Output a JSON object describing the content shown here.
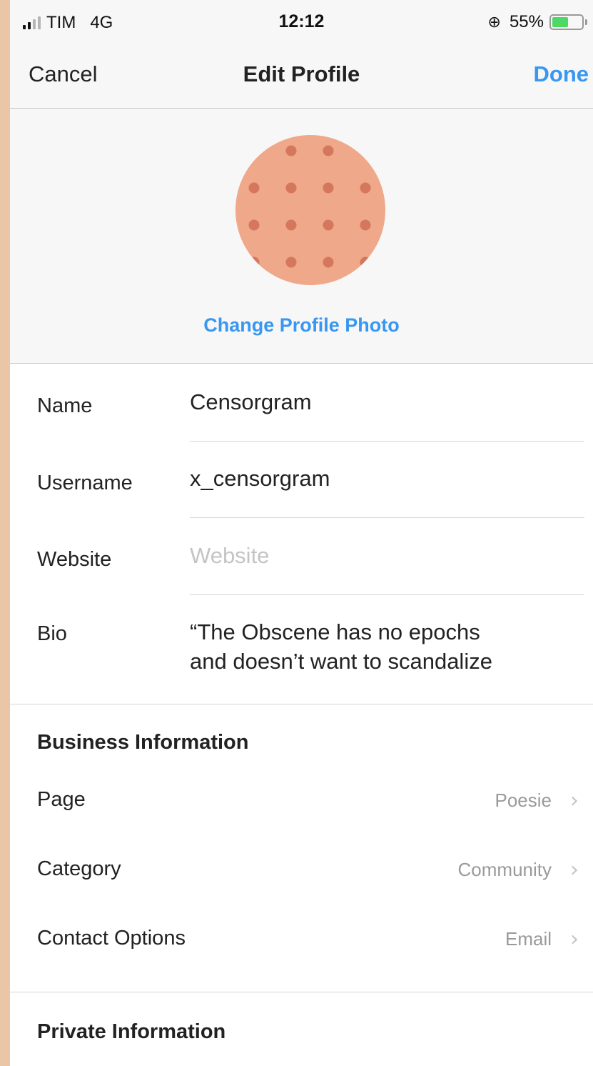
{
  "status_bar": {
    "carrier": "TIM",
    "network": "4G",
    "time": "12:12",
    "battery": "55%",
    "battery_level": 0.55
  },
  "nav": {
    "cancel": "Cancel",
    "title": "Edit Profile",
    "done": "Done"
  },
  "profile": {
    "change_photo": "Change Profile Photo"
  },
  "fields": {
    "name": {
      "label": "Name",
      "value": "Censorgram"
    },
    "username": {
      "label": "Username",
      "value": "x_censorgram"
    },
    "website": {
      "label": "Website",
      "value": "",
      "placeholder": "Website"
    },
    "bio": {
      "label": "Bio",
      "line1": "“The Obscene has no epochs",
      "line2": "and doesn’t want to scandalize"
    }
  },
  "business": {
    "header": "Business Information",
    "items": [
      {
        "label": "Page",
        "value": "Poesie"
      },
      {
        "label": "Category",
        "value": "Community"
      },
      {
        "label": "Contact Options",
        "value": "Email"
      }
    ]
  },
  "private": {
    "header": "Private Information"
  },
  "colors": {
    "accent": "#3897f0",
    "background": "#e9c6a6",
    "battery": "#4cd964"
  },
  "icons": [
    "signal-icon",
    "alarm-lock-icon",
    "battery-icon",
    "chevron-right-icon"
  ]
}
